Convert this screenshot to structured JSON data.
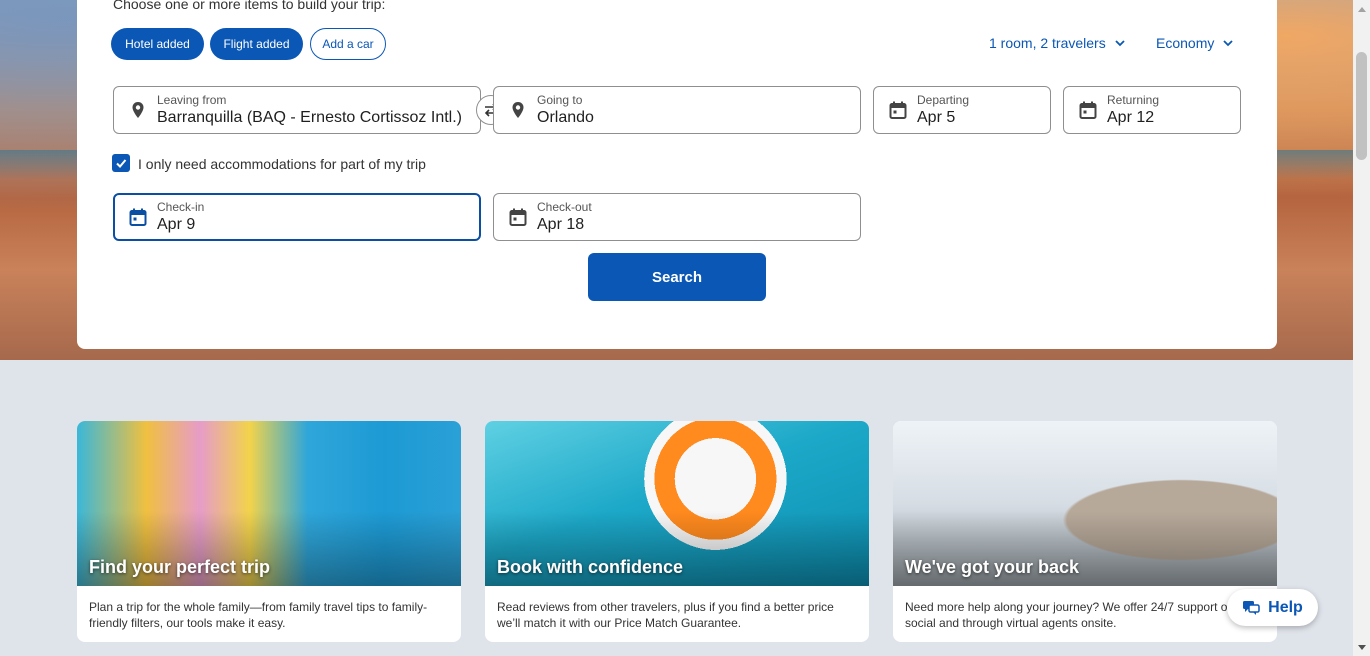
{
  "builder": {
    "prompt": "Choose one or more items to build your trip:",
    "pills": [
      {
        "label": "Hotel added",
        "state": "added"
      },
      {
        "label": "Flight added",
        "state": "added"
      },
      {
        "label": "Add a car",
        "state": "add"
      }
    ],
    "rooms": "1 room, 2 travelers",
    "cabin": "Economy"
  },
  "fields": {
    "leaving": {
      "label": "Leaving from",
      "value": "Barranquilla (BAQ - Ernesto Cortissoz Intl.)",
      "icon": "location-pin-icon"
    },
    "going": {
      "label": "Going to",
      "value": "Orlando",
      "icon": "location-pin-icon"
    },
    "departing": {
      "label": "Departing",
      "value": "Apr 5",
      "icon": "calendar-icon"
    },
    "returning": {
      "label": "Returning",
      "value": "Apr 12",
      "icon": "calendar-icon"
    },
    "checkin": {
      "label": "Check-in",
      "value": "Apr 9",
      "icon": "calendar-icon"
    },
    "checkout": {
      "label": "Check-out",
      "value": "Apr 18",
      "icon": "calendar-icon"
    }
  },
  "partial_stay": {
    "label": "I only need accommodations for part of my trip",
    "checked": true
  },
  "search_label": "Search",
  "features": [
    {
      "title": "Find your perfect trip",
      "desc": "Plan a trip for the whole family—from family travel tips to family-friendly filters, our tools make it easy."
    },
    {
      "title": "Book with confidence",
      "desc": "Read reviews from other travelers, plus if you find a better price we’ll match it with our Price Match Guarantee."
    },
    {
      "title": "We've got your back",
      "desc": "Need more help along your journey? We offer 24/7 support on social and through virtual agents onsite."
    }
  ],
  "help_label": "Help",
  "colors": {
    "accent": "#0b57b5",
    "background": "#dfe3ea"
  }
}
